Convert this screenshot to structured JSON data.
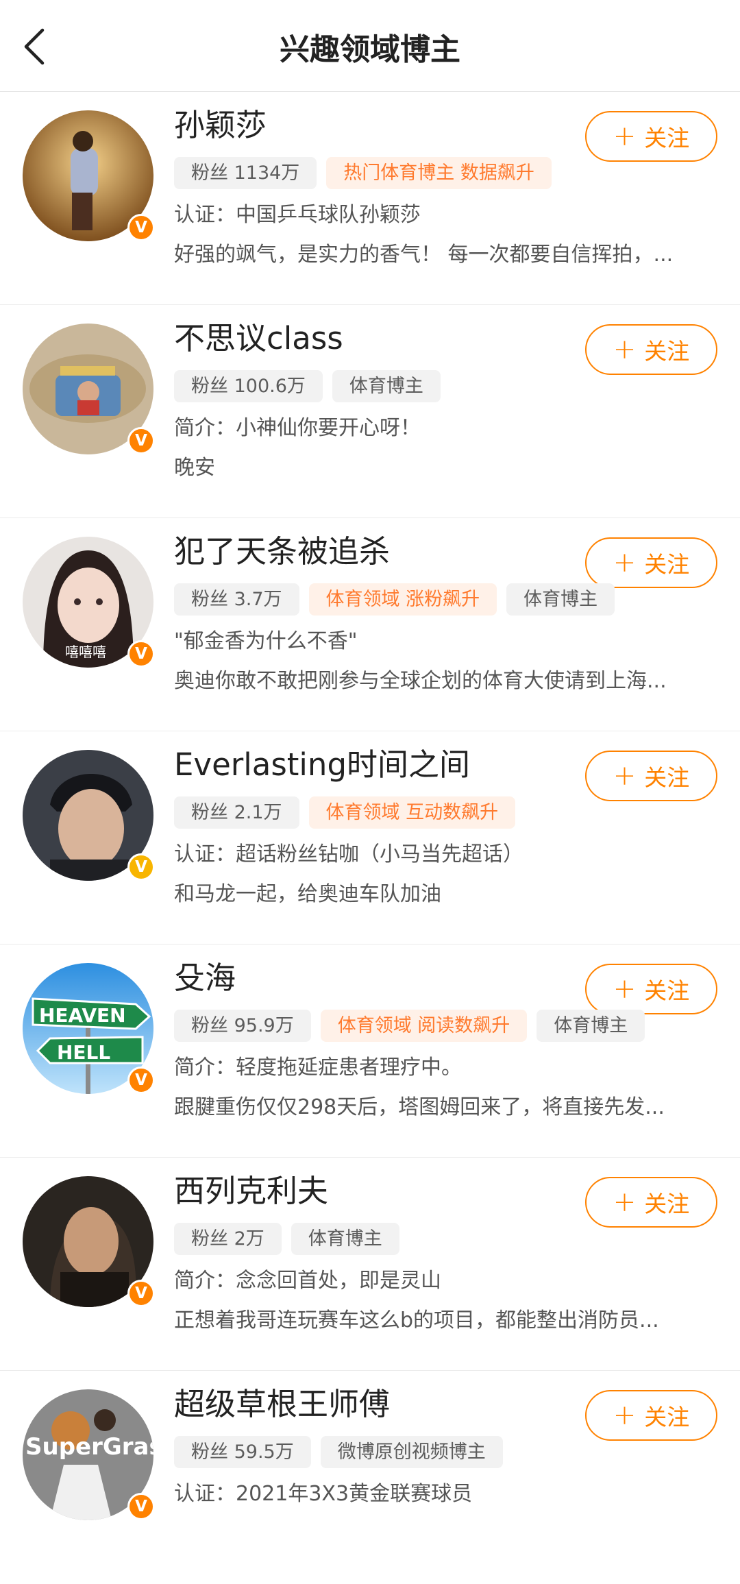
{
  "header": {
    "title": "兴趣领域博主"
  },
  "follow_label": "关注",
  "colors": {
    "accent": "#ff8200",
    "tag_orange_text": "#ff7a2e",
    "tag_orange_bg": "#fff1e8",
    "tag_gray_bg": "#f2f2f2"
  },
  "items": [
    {
      "name": "孙颖莎",
      "fans": "粉丝 1134万",
      "tag_hot": "热门体育博主 数据飙升",
      "line1": "认证：中国乒乓球队孙颖莎",
      "line2": "好强的飒气，是实力的香气！ 每一次都要自信挥拍，..."
    },
    {
      "name": "不思议class",
      "fans": "粉丝 100.6万",
      "tag_cat": "体育博主",
      "line1": "简介：小神仙你要开心呀！",
      "line2": "晚安"
    },
    {
      "name": "犯了天条被追杀",
      "fans": "粉丝 3.7万",
      "tag_hot": "体育领域 涨粉飙升",
      "tag_cat": "体育博主",
      "line1": "\"郁金香为什么不香\"",
      "line2": "奥迪你敢不敢把刚参与全球企划的体育大使请到上海...",
      "avatar_caption": "嘻嘻嘻"
    },
    {
      "name": "Everlasting时间之间",
      "fans": "粉丝 2.1万",
      "tag_hot": "体育领域 互动数飙升",
      "line1": "认证：超话粉丝钻咖（小马当先超话）",
      "line2": "和马龙一起，给奥迪车队加油"
    },
    {
      "name": "殳海",
      "fans": "粉丝 95.9万",
      "tag_hot": "体育领域 阅读数飙升",
      "tag_cat": "体育博主",
      "line1": "简介：轻度拖延症患者理疗中。",
      "line2": "跟腱重伤仅仅298天后，塔图姆回来了，将直接先发...",
      "sign_top": "HEAVEN",
      "sign_bottom": "HELL"
    },
    {
      "name": "西列克利夫",
      "fans": "粉丝 2万",
      "tag_cat": "体育博主",
      "line1": "简介：念念回首处，即是灵山",
      "line2": "正想着我哥连玩赛车这么b的项目，都能整出消防员..."
    },
    {
      "name": "超级草根王师傅",
      "fans": "粉丝 59.5万",
      "tag_cat": "微博原创视频博主",
      "line1": "认证：2021年3X3黄金联赛球员",
      "avatar_caption": "SuperGrass"
    }
  ]
}
